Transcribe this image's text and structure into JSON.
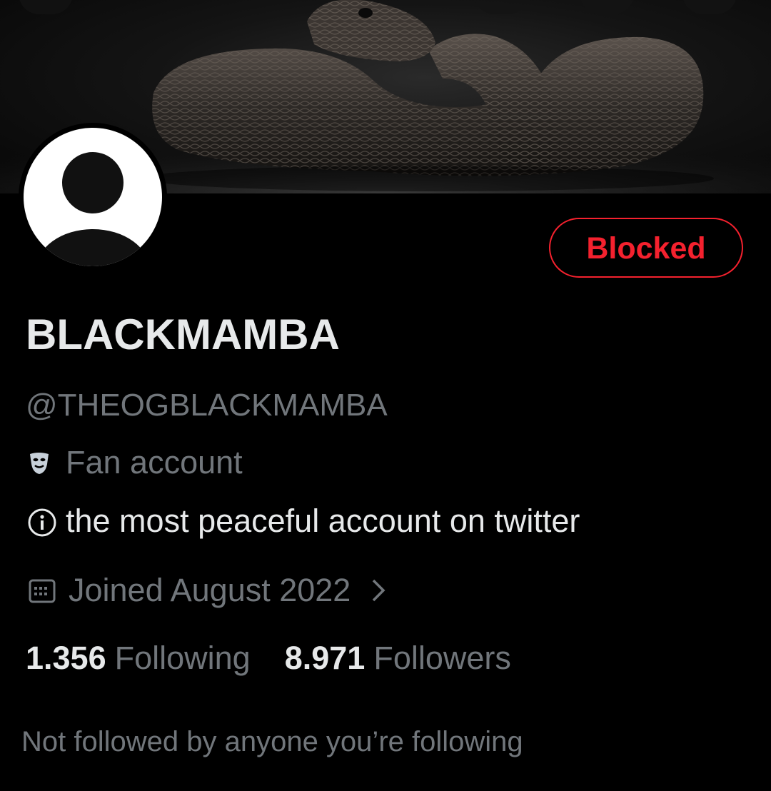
{
  "header": {
    "back_icon": "back-arrow-icon",
    "icons": [
      "share-icon",
      "search-icon",
      "more-icon"
    ]
  },
  "profile": {
    "display_name": "BLACKMAMBA",
    "handle": "@THEOGBLACKMAMBA",
    "category": "Fan account",
    "category_icon": "theater-masks-icon",
    "bio": "the most peaceful account on twitter",
    "bio_icon": "info-icon",
    "joined": "Joined August 2022",
    "joined_icon": "calendar-icon",
    "following_count": "1.356",
    "following_label": "Following",
    "followers_count": "8.971",
    "followers_label": "Followers",
    "mutuals_note": "Not followed by anyone you’re following"
  },
  "action": {
    "blocked_label": "Blocked"
  },
  "colors": {
    "background": "#000000",
    "text_primary": "#e7e9ea",
    "text_secondary": "#71767b",
    "blocked_red": "#f4212e"
  }
}
